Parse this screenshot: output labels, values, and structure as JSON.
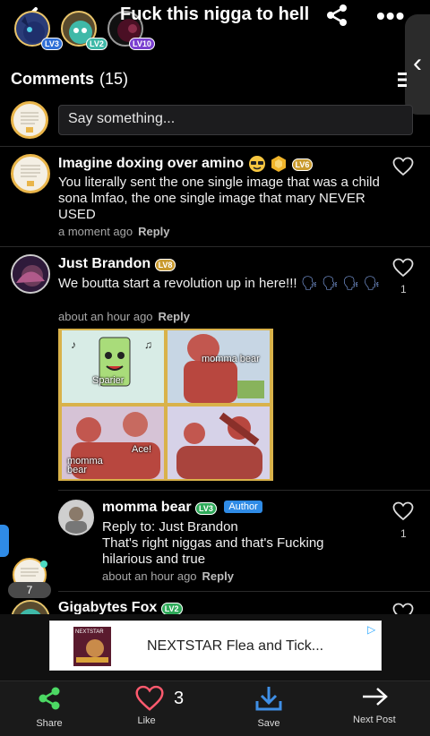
{
  "header": {
    "title": "Fuck this nigga to hell",
    "avatars": [
      {
        "level": "LV3",
        "color": "#2f6fd6"
      },
      {
        "level": "LV2",
        "color": "#3fb9a8"
      },
      {
        "level": "LV10",
        "color": "#7a3fd0"
      }
    ]
  },
  "comments_header": {
    "label": "Comments",
    "count": "(15)"
  },
  "compose": {
    "placeholder": "Say something..."
  },
  "comments": [
    {
      "name": "Imagine doxing over amino",
      "level": "LV6",
      "text": "You literally sent the one single image that was a child sona lmfao, the one single image that mary NEVER USED",
      "time": "a moment ago",
      "reply": "Reply",
      "likes": ""
    },
    {
      "name": "Just Brandon",
      "level": "LV8",
      "text": "We boutta start a revolution up in here!!!",
      "time": "about an hour ago",
      "reply": "Reply",
      "likes": "1",
      "meme_labels": {
        "sparier": "Sparier",
        "momma_bear_top": "momma bear",
        "ace": "Ace!",
        "momma_bear_bottom": "momma\nbear"
      }
    },
    {
      "name": "momma bear",
      "level": "LV3",
      "author_tag": "Author",
      "reply_to": "Reply to: Just Brandon",
      "text": "That's right niggas and that's Fucking hilarious and true",
      "time": "about an hour ago",
      "reply": "Reply",
      "likes": "1"
    },
    {
      "name": "Gigabytes Fox",
      "level": "LV2"
    }
  ],
  "online_count": "7",
  "ad": {
    "text": "NEXTSTAR Flea and Tick...",
    "product_label": "NEXTSTAR"
  },
  "bottom_bar": {
    "share": "Share",
    "like": "Like",
    "like_count": "3",
    "save": "Save",
    "next": "Next Post"
  },
  "colors": {
    "accent": "#2f8be6",
    "green": "#4cd964",
    "like_red": "#ff5a6e"
  }
}
